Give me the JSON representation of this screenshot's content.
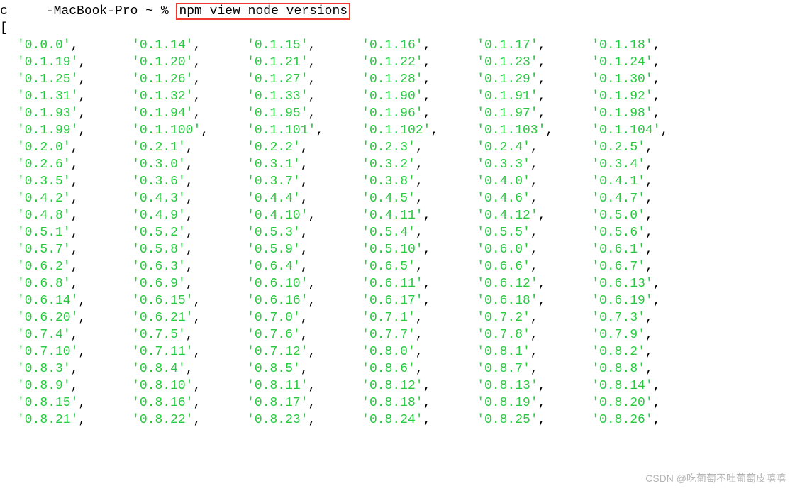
{
  "prompt": {
    "user_host_visible_prefix": "c",
    "user_host_visible_suffix": "-MacBook-Pro ~ %",
    "command": "npm view node versions"
  },
  "array_open": "[",
  "col_pads": [
    15,
    15,
    15,
    15,
    15,
    0
  ],
  "versions": [
    [
      "0.0.0",
      "0.1.14",
      "0.1.15",
      "0.1.16",
      "0.1.17",
      "0.1.18"
    ],
    [
      "0.1.19",
      "0.1.20",
      "0.1.21",
      "0.1.22",
      "0.1.23",
      "0.1.24"
    ],
    [
      "0.1.25",
      "0.1.26",
      "0.1.27",
      "0.1.28",
      "0.1.29",
      "0.1.30"
    ],
    [
      "0.1.31",
      "0.1.32",
      "0.1.33",
      "0.1.90",
      "0.1.91",
      "0.1.92"
    ],
    [
      "0.1.93",
      "0.1.94",
      "0.1.95",
      "0.1.96",
      "0.1.97",
      "0.1.98"
    ],
    [
      "0.1.99",
      "0.1.100",
      "0.1.101",
      "0.1.102",
      "0.1.103",
      "0.1.104"
    ],
    [
      "0.2.0",
      "0.2.1",
      "0.2.2",
      "0.2.3",
      "0.2.4",
      "0.2.5"
    ],
    [
      "0.2.6",
      "0.3.0",
      "0.3.1",
      "0.3.2",
      "0.3.3",
      "0.3.4"
    ],
    [
      "0.3.5",
      "0.3.6",
      "0.3.7",
      "0.3.8",
      "0.4.0",
      "0.4.1"
    ],
    [
      "0.4.2",
      "0.4.3",
      "0.4.4",
      "0.4.5",
      "0.4.6",
      "0.4.7"
    ],
    [
      "0.4.8",
      "0.4.9",
      "0.4.10",
      "0.4.11",
      "0.4.12",
      "0.5.0"
    ],
    [
      "0.5.1",
      "0.5.2",
      "0.5.3",
      "0.5.4",
      "0.5.5",
      "0.5.6"
    ],
    [
      "0.5.7",
      "0.5.8",
      "0.5.9",
      "0.5.10",
      "0.6.0",
      "0.6.1"
    ],
    [
      "0.6.2",
      "0.6.3",
      "0.6.4",
      "0.6.5",
      "0.6.6",
      "0.6.7"
    ],
    [
      "0.6.8",
      "0.6.9",
      "0.6.10",
      "0.6.11",
      "0.6.12",
      "0.6.13"
    ],
    [
      "0.6.14",
      "0.6.15",
      "0.6.16",
      "0.6.17",
      "0.6.18",
      "0.6.19"
    ],
    [
      "0.6.20",
      "0.6.21",
      "0.7.0",
      "0.7.1",
      "0.7.2",
      "0.7.3"
    ],
    [
      "0.7.4",
      "0.7.5",
      "0.7.6",
      "0.7.7",
      "0.7.8",
      "0.7.9"
    ],
    [
      "0.7.10",
      "0.7.11",
      "0.7.12",
      "0.8.0",
      "0.8.1",
      "0.8.2"
    ],
    [
      "0.8.3",
      "0.8.4",
      "0.8.5",
      "0.8.6",
      "0.8.7",
      "0.8.8"
    ],
    [
      "0.8.9",
      "0.8.10",
      "0.8.11",
      "0.8.12",
      "0.8.13",
      "0.8.14"
    ],
    [
      "0.8.15",
      "0.8.16",
      "0.8.17",
      "0.8.18",
      "0.8.19",
      "0.8.20"
    ],
    [
      "0.8.21",
      "0.8.22",
      "0.8.23",
      "0.8.24",
      "0.8.25",
      "0.8.26"
    ]
  ],
  "watermark": "CSDN @吃葡萄不吐葡萄皮嘻嘻"
}
